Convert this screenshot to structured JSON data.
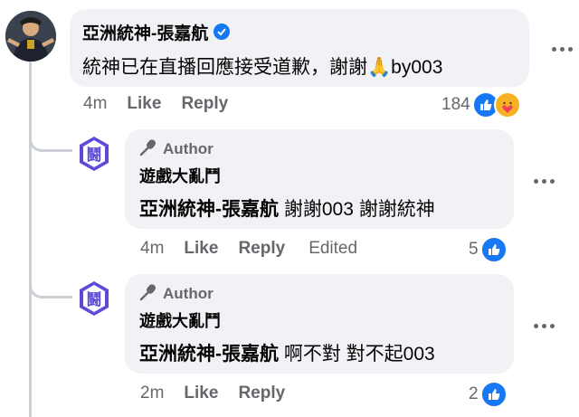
{
  "main_comment": {
    "author": "亞洲統神-張嘉航",
    "text": "統神已在直播回應接受道歉，謝謝",
    "emoji": "🙏",
    "suffix": "by003",
    "time": "4m",
    "like_label": "Like",
    "reply_label": "Reply",
    "reaction_count": "184",
    "reaction_icons": [
      "like-icon",
      "care-icon"
    ],
    "verified_icon": "verified-badge-icon"
  },
  "replies": [
    {
      "badge": "Author",
      "page_name": "遊戲大亂鬥",
      "mention": "亞洲統神-張嘉航",
      "text": "謝謝003 謝謝統神",
      "time": "4m",
      "like_label": "Like",
      "reply_label": "Reply",
      "edited_label": "Edited",
      "reaction_count": "5"
    },
    {
      "badge": "Author",
      "page_name": "遊戲大亂鬥",
      "mention": "亞洲統神-張嘉航",
      "text": "啊不對 對不起003",
      "time": "2m",
      "like_label": "Like",
      "reply_label": "Reply",
      "reaction_count": "2"
    }
  ],
  "page_avatar_glyph": "鬪",
  "colors": {
    "accent": "#1877f2",
    "bubble": "#f0f2f5",
    "muted_text": "#65676b",
    "avatar_badge": "#5b4bd6"
  }
}
